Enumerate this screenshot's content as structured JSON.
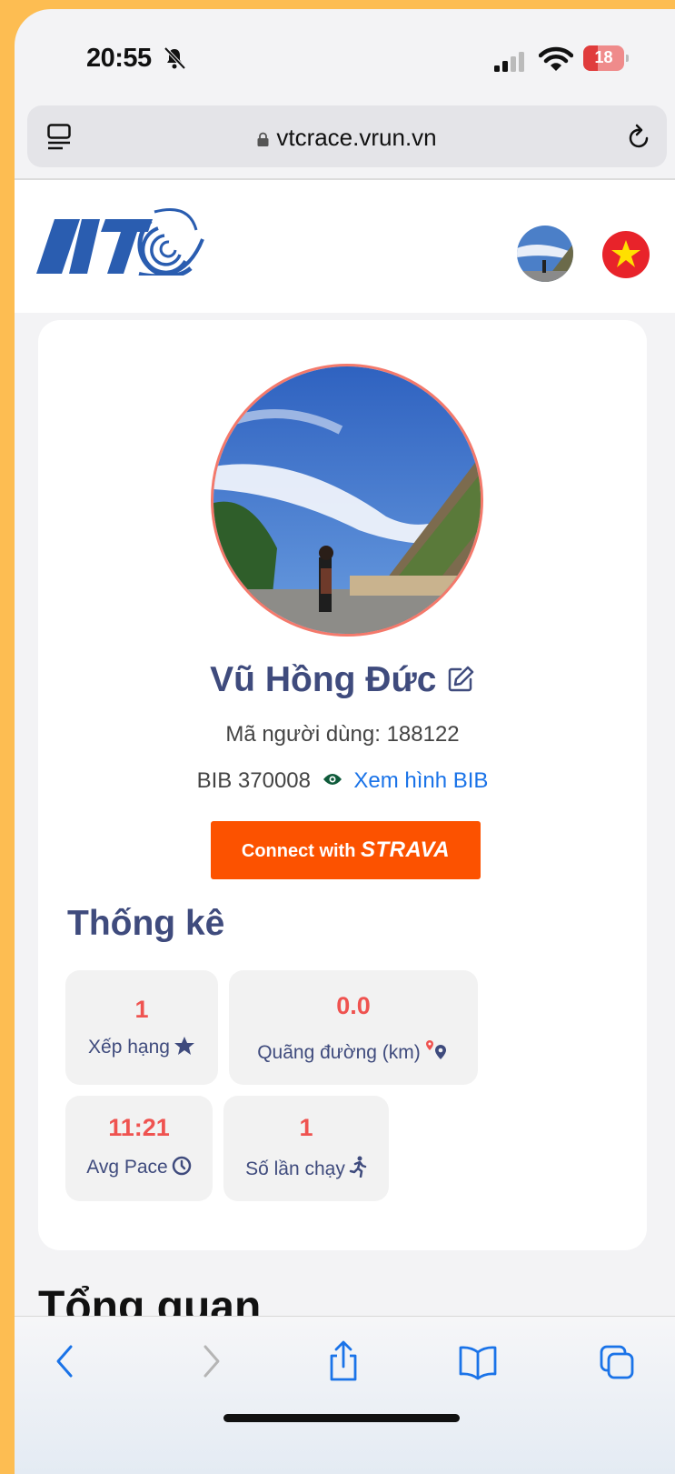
{
  "status_bar": {
    "time": "20:55",
    "battery": "18"
  },
  "browser": {
    "url": "vtcrace.vrun.vn"
  },
  "header": {
    "logo": "VTC",
    "language_flag": "vietnam-flag"
  },
  "profile": {
    "name": "Vũ Hồng Đức",
    "user_id_label": "Mã người dùng: 188122",
    "bib_label": "BIB 370008",
    "bib_link": "Xem hình BIB",
    "strava_prefix": "Connect with",
    "strava_brand": "STRAVA"
  },
  "stats": {
    "title": "Thống kê",
    "items": [
      {
        "value": "1",
        "label": "Xếp hạng",
        "icon": "star-icon"
      },
      {
        "value": "0.0",
        "label": "Quãng đường (km)",
        "icon": "route-pin-icon"
      },
      {
        "value": "11:21",
        "label": "Avg Pace",
        "icon": "clock-icon"
      },
      {
        "value": "1",
        "label": "Số lần chạy",
        "icon": "runner-icon"
      }
    ]
  },
  "overview_title": "Tổng quan",
  "colors": {
    "accent": "#fc5200",
    "heading": "#3f4b7d",
    "value": "#ef5350",
    "frame": "#fdbd52"
  }
}
